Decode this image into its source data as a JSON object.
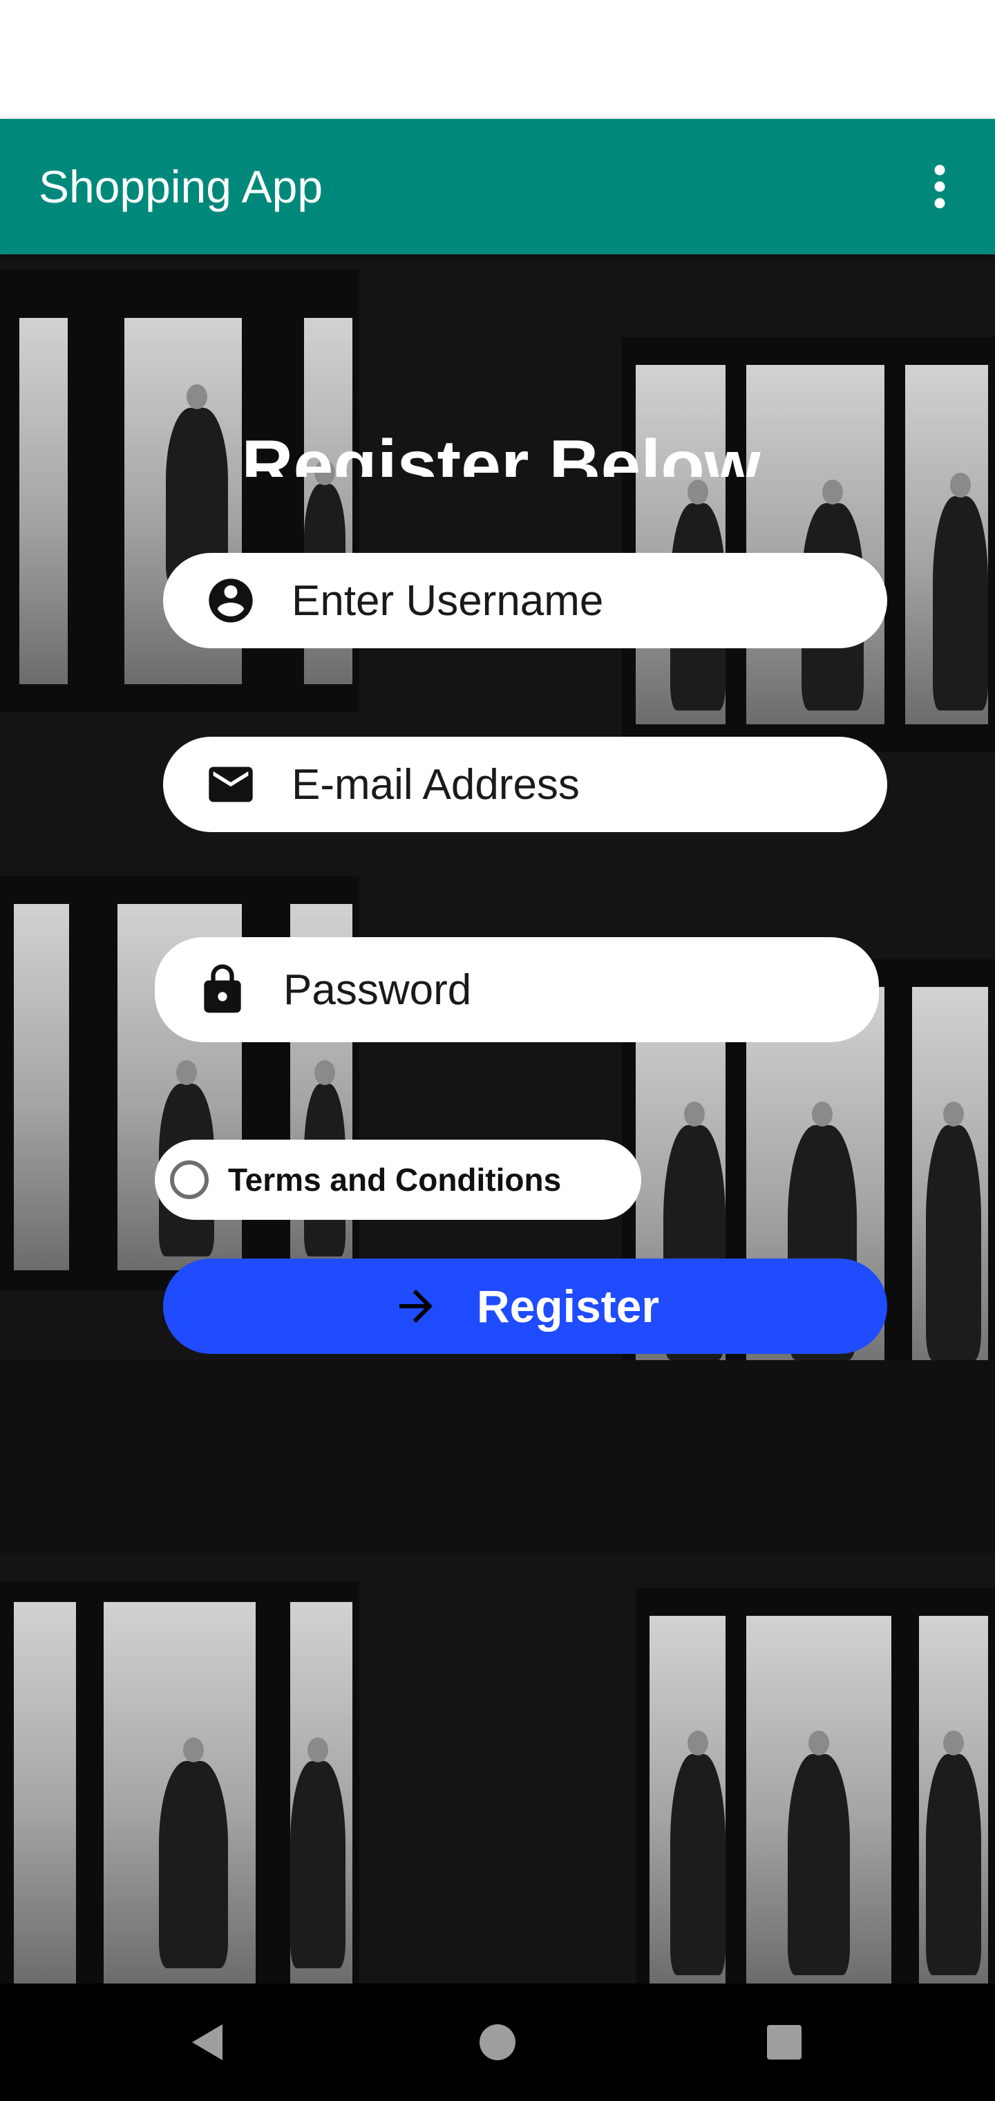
{
  "app_bar": {
    "title": "Shopping App",
    "menu_icon": "more-vert-icon",
    "color": "#00897b"
  },
  "form": {
    "heading": "Register Below",
    "username": {
      "placeholder": "Enter Username",
      "value": "",
      "icon": "account-circle-icon"
    },
    "email": {
      "placeholder": "E-mail Address",
      "value": "",
      "icon": "mail-icon"
    },
    "password": {
      "placeholder": "Password",
      "value": "",
      "icon": "lock-icon"
    },
    "terms": {
      "label": "Terms and Conditions",
      "checked": false
    },
    "register_button": {
      "label": "Register",
      "icon": "arrow-forward-icon",
      "color": "#1f4cff"
    }
  },
  "nav_bar": {
    "back_icon": "back-triangle-icon",
    "home_icon": "home-circle-icon",
    "recents_icon": "recents-square-icon"
  }
}
